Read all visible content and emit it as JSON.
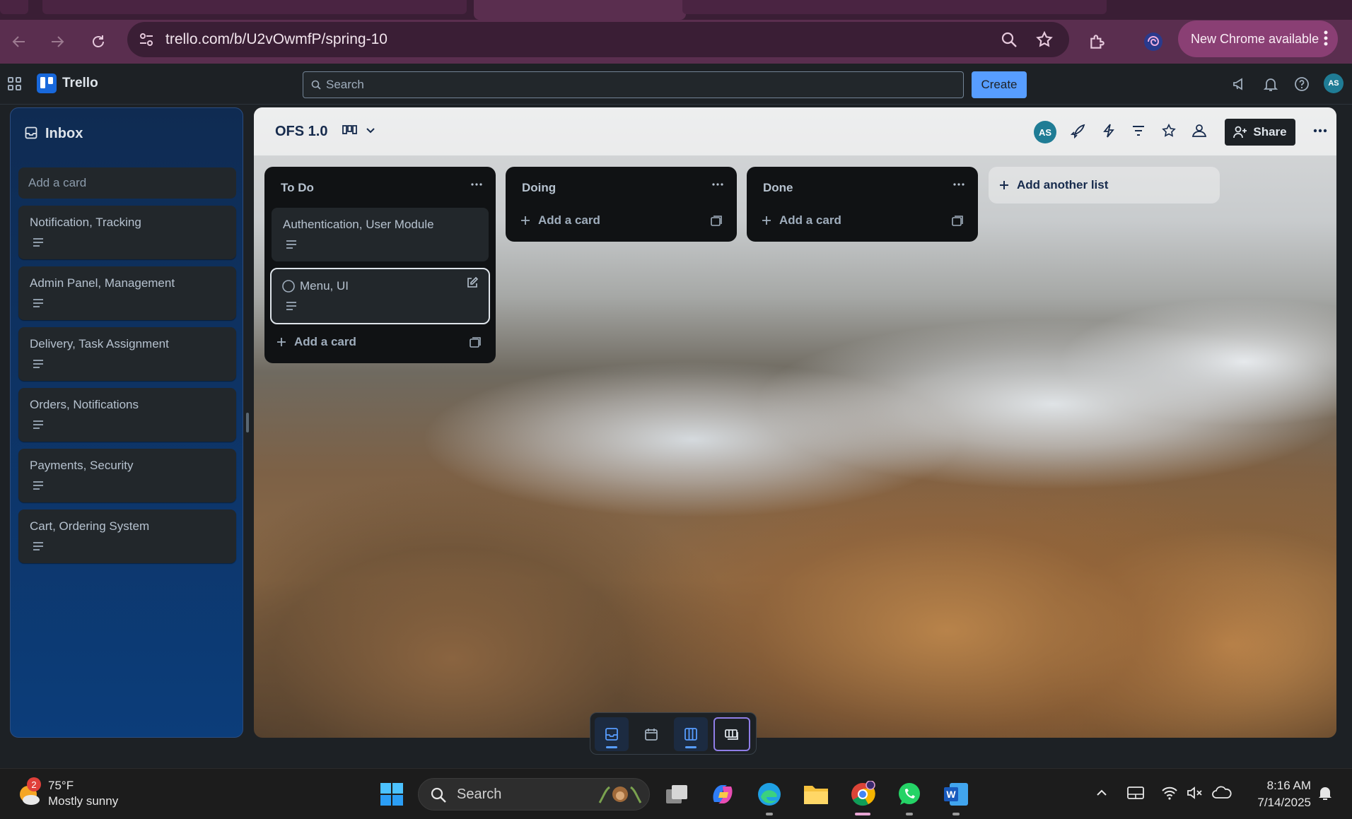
{
  "browser": {
    "url": "trello.com/b/U2vOwmfP/spring-10",
    "new_chrome_label": "New Chrome available"
  },
  "trello": {
    "logo_text": "Trello",
    "search_placeholder": "Search",
    "create_label": "Create",
    "avatar_initials": "AS"
  },
  "inbox": {
    "title": "Inbox",
    "add_card_label": "Add a card",
    "cards": [
      {
        "title": "Notification, Tracking"
      },
      {
        "title": "Admin Panel, Management"
      },
      {
        "title": "Delivery, Task Assignment"
      },
      {
        "title": "Orders, Notifications"
      },
      {
        "title": "Payments, Security"
      },
      {
        "title": "Cart, Ordering System"
      }
    ]
  },
  "board": {
    "title": "OFS 1.0",
    "member_initials": "AS",
    "share_label": "Share",
    "lists": [
      {
        "title": "To Do",
        "cards": [
          {
            "title": "Authentication, User Module"
          },
          {
            "title": "Menu, UI"
          }
        ],
        "add_card_label": "Add a card"
      },
      {
        "title": "Doing",
        "cards": [],
        "add_card_label": "Add a card"
      },
      {
        "title": "Done",
        "cards": [],
        "add_card_label": "Add a card"
      }
    ],
    "add_list_label": "Add another list"
  },
  "switcher": {
    "views": [
      "inbox",
      "planner",
      "board",
      "switch-boards"
    ],
    "active": [
      "inbox",
      "board"
    ]
  },
  "taskbar": {
    "weather_badge": "2",
    "weather_temp": "75°F",
    "weather_desc": "Mostly sunny",
    "search_placeholder": "Search",
    "time": "8:16 AM",
    "date": "7/14/2025"
  },
  "colors": {
    "chrome_frame": "#5a2e4f",
    "trello_bg": "#1d2125",
    "create_button": "#579dff",
    "inbox_gradient_top": "#0f2b52",
    "inbox_gradient_bottom": "#0c3d7a",
    "list_bg": "#101214",
    "card_bg": "#22272b"
  }
}
